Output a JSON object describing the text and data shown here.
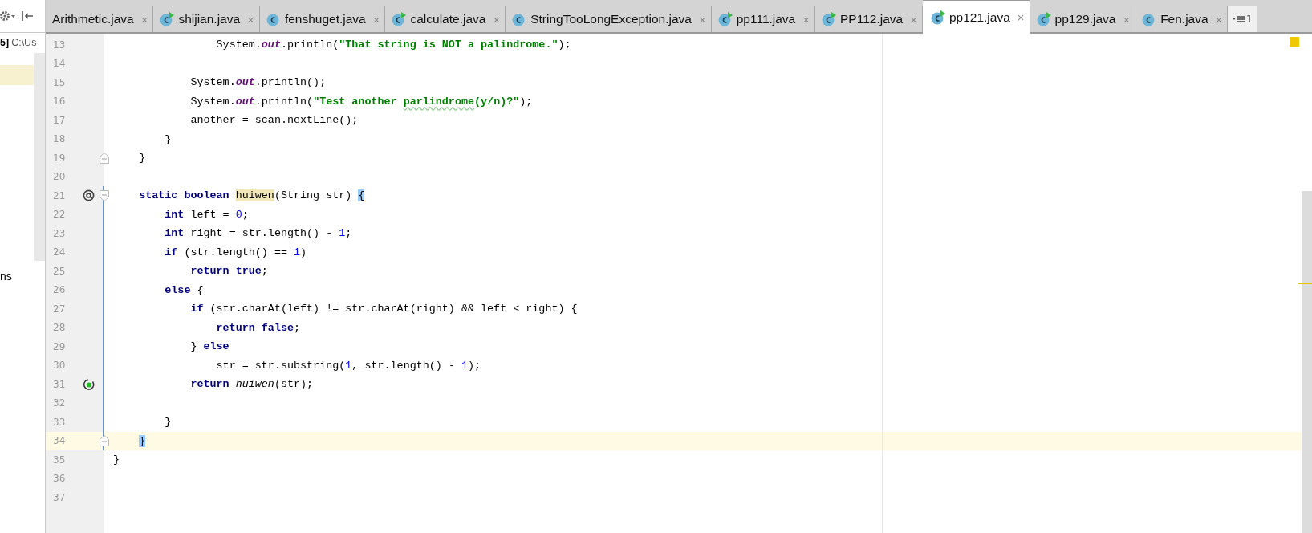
{
  "project_panel": {
    "header_text": "5]",
    "path_text": "C:\\Us",
    "items": [
      {
        "selected": true
      },
      {
        "text": "ns",
        "selected": false
      }
    ]
  },
  "tabs": [
    {
      "label": "Arithmetic.java",
      "kind": "plain",
      "close": "×",
      "selected": false
    },
    {
      "label": "shijian.java",
      "kind": "runnable",
      "close": "×",
      "selected": false
    },
    {
      "label": "fenshuget.java",
      "kind": "class",
      "close": "×",
      "selected": false
    },
    {
      "label": "calculate.java",
      "kind": "runnable",
      "close": "×",
      "selected": false
    },
    {
      "label": "StringTooLongException.java",
      "kind": "class",
      "close": "×",
      "selected": false
    },
    {
      "label": "pp111.java",
      "kind": "runnable",
      "close": "×",
      "selected": false
    },
    {
      "label": "PP112.java",
      "kind": "runnable",
      "close": "×",
      "selected": false
    },
    {
      "label": "pp121.java",
      "kind": "runnable",
      "close": "×",
      "selected": true
    },
    {
      "label": "pp129.java",
      "kind": "runnable",
      "close": "×",
      "selected": false
    },
    {
      "label": "Fen.java",
      "kind": "class",
      "close": "×",
      "selected": false
    }
  ],
  "tab_overflow": {
    "count": "1"
  },
  "lines": [
    {
      "number": "13",
      "current": false,
      "changed": false,
      "tokens": [
        {
          "kind": "plain",
          "text": "                System."
        },
        {
          "kind": "field",
          "text": "out"
        },
        {
          "kind": "plain",
          "text": ".println("
        },
        {
          "kind": "string",
          "text": "\"That string is NOT a palindrome.\""
        },
        {
          "kind": "plain",
          "text": ");"
        }
      ]
    },
    {
      "number": "14",
      "current": false,
      "changed": false
    },
    {
      "number": "15",
      "current": false,
      "changed": false,
      "tokens": [
        {
          "kind": "plain",
          "text": "            System."
        },
        {
          "kind": "field",
          "text": "out"
        },
        {
          "kind": "plain",
          "text": ".println();"
        }
      ]
    },
    {
      "number": "16",
      "current": false,
      "changed": false,
      "tokens": [
        {
          "kind": "plain",
          "text": "            System."
        },
        {
          "kind": "field",
          "text": "out"
        },
        {
          "kind": "plain",
          "text": ".println("
        },
        {
          "kind": "string",
          "text": "\"Test another ",
          "typo": false
        },
        {
          "kind": "string",
          "text": "parlindrome",
          "typo": true
        },
        {
          "kind": "string",
          "text": "(y/n)?\"",
          "typo": false
        },
        {
          "kind": "plain",
          "text": ");"
        }
      ]
    },
    {
      "number": "17",
      "current": false,
      "changed": false,
      "tokens": [
        {
          "kind": "plain",
          "text": "            another = scan.nextLine();"
        }
      ]
    },
    {
      "number": "18",
      "current": false,
      "changed": false,
      "tokens": [
        {
          "kind": "plain",
          "text": "        }"
        }
      ]
    },
    {
      "number": "19",
      "current": false,
      "changed": false,
      "gutter": [
        {
          "kind": "fold-end"
        }
      ],
      "tokens": [
        {
          "kind": "plain",
          "text": "    }"
        }
      ]
    },
    {
      "number": "20",
      "current": false,
      "changed": false
    },
    {
      "number": "21",
      "current": false,
      "changed": true,
      "gutter": [
        {
          "kind": "implements"
        },
        {
          "kind": "fold-start"
        }
      ],
      "tokens": [
        {
          "kind": "keyword",
          "text": "    static boolean "
        },
        {
          "kind": "declaration",
          "text": "huiwen"
        },
        {
          "kind": "plain",
          "text": "(String str) "
        },
        {
          "kind": "brace-match",
          "text": "{"
        }
      ]
    },
    {
      "number": "22",
      "current": false,
      "changed": true,
      "tokens": [
        {
          "kind": "keyword",
          "text": "        int"
        },
        {
          "kind": "plain",
          "text": " left = "
        },
        {
          "kind": "number",
          "text": "0"
        },
        {
          "kind": "plain",
          "text": ";"
        }
      ]
    },
    {
      "number": "23",
      "current": false,
      "changed": true,
      "tokens": [
        {
          "kind": "keyword",
          "text": "        int"
        },
        {
          "kind": "plain",
          "text": " right = str.length() - "
        },
        {
          "kind": "number",
          "text": "1"
        },
        {
          "kind": "plain",
          "text": ";"
        }
      ]
    },
    {
      "number": "24",
      "current": false,
      "changed": true,
      "tokens": [
        {
          "kind": "keyword",
          "text": "        if"
        },
        {
          "kind": "plain",
          "text": " (str.length() == "
        },
        {
          "kind": "number",
          "text": "1"
        },
        {
          "kind": "plain",
          "text": ")"
        }
      ]
    },
    {
      "number": "25",
      "current": false,
      "changed": true,
      "tokens": [
        {
          "kind": "keyword",
          "text": "            return true"
        },
        {
          "kind": "plain",
          "text": ";"
        }
      ]
    },
    {
      "number": "26",
      "current": false,
      "changed": true,
      "tokens": [
        {
          "kind": "keyword",
          "text": "        else"
        },
        {
          "kind": "plain",
          "text": " {"
        }
      ]
    },
    {
      "number": "27",
      "current": false,
      "changed": true,
      "tokens": [
        {
          "kind": "keyword",
          "text": "            if"
        },
        {
          "kind": "plain",
          "text": " (str.charAt(left) != str.charAt(right) && left < right) {"
        }
      ]
    },
    {
      "number": "28",
      "current": false,
      "changed": true,
      "tokens": [
        {
          "kind": "keyword",
          "text": "                return false"
        },
        {
          "kind": "plain",
          "text": ";"
        }
      ]
    },
    {
      "number": "29",
      "current": false,
      "changed": true,
      "tokens": [
        {
          "kind": "plain",
          "text": "            } "
        },
        {
          "kind": "keyword",
          "text": "else"
        }
      ]
    },
    {
      "number": "30",
      "current": false,
      "changed": true,
      "tokens": [
        {
          "kind": "plain",
          "text": "                str = str.substring("
        },
        {
          "kind": "number",
          "text": "1"
        },
        {
          "kind": "plain",
          "text": ", str.length() - "
        },
        {
          "kind": "number",
          "text": "1"
        },
        {
          "kind": "plain",
          "text": ");"
        }
      ]
    },
    {
      "number": "31",
      "current": false,
      "changed": true,
      "gutter": [
        {
          "kind": "recursive"
        }
      ],
      "tokens": [
        {
          "kind": "keyword",
          "text": "            return "
        },
        {
          "kind": "call",
          "text": "huiwen"
        },
        {
          "kind": "plain",
          "text": "(str);"
        }
      ]
    },
    {
      "number": "32",
      "current": false,
      "changed": true
    },
    {
      "number": "33",
      "current": false,
      "changed": true,
      "tokens": [
        {
          "kind": "plain",
          "text": "        }"
        }
      ]
    },
    {
      "number": "34",
      "current": true,
      "changed": true,
      "gutter": [
        {
          "kind": "fold-end"
        }
      ],
      "tokens": [
        {
          "kind": "brace-match",
          "text": "    }"
        }
      ]
    },
    {
      "number": "35",
      "current": false,
      "changed": false,
      "tokens": [
        {
          "kind": "plain",
          "text": "}"
        }
      ]
    },
    {
      "number": "36",
      "current": false,
      "changed": false
    },
    {
      "number": "37",
      "current": false,
      "changed": false
    }
  ]
}
